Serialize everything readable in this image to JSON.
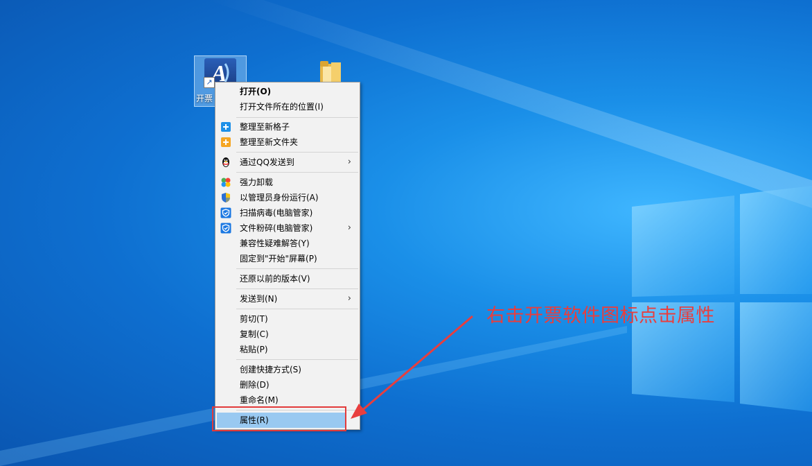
{
  "desktop": {
    "icons": [
      {
        "label": "开票",
        "name": "invoice-software",
        "icon": "app-shortcut-icon"
      },
      {
        "label": "",
        "name": "folder",
        "icon": "folder-icon"
      }
    ]
  },
  "context_menu": {
    "items": [
      {
        "label": "打开(O)",
        "bold": true
      },
      {
        "label": "打开文件所在的位置(I)"
      },
      {
        "label": "整理至新格子",
        "icon": "plus-blue-icon"
      },
      {
        "label": "整理至新文件夹",
        "icon": "plus-orange-icon"
      },
      {
        "label": "通过QQ发送到",
        "icon": "qq-penguin-icon",
        "submenu": true
      },
      {
        "label": "强力卸载",
        "icon": "clover-icon"
      },
      {
        "label": "以管理员身份运行(A)",
        "icon": "uac-shield-icon"
      },
      {
        "label": "扫描病毒(电脑管家)",
        "icon": "tencent-shield-icon"
      },
      {
        "label": "文件粉碎(电脑管家)",
        "icon": "tencent-shield-icon",
        "submenu": true
      },
      {
        "label": "兼容性疑难解答(Y)"
      },
      {
        "label": "固定到\"开始\"屏幕(P)"
      },
      {
        "label": "还原以前的版本(V)"
      },
      {
        "label": "发送到(N)",
        "submenu": true
      },
      {
        "label": "剪切(T)"
      },
      {
        "label": "复制(C)"
      },
      {
        "label": "粘贴(P)"
      },
      {
        "label": "创建快捷方式(S)"
      },
      {
        "label": "删除(D)"
      },
      {
        "label": "重命名(M)"
      },
      {
        "label": "属性(R)",
        "highlighted": true
      }
    ],
    "submenu_glyph": "›"
  },
  "annotation": {
    "text": "右击开票软件图标点击属性",
    "color": "#e83e3e"
  }
}
